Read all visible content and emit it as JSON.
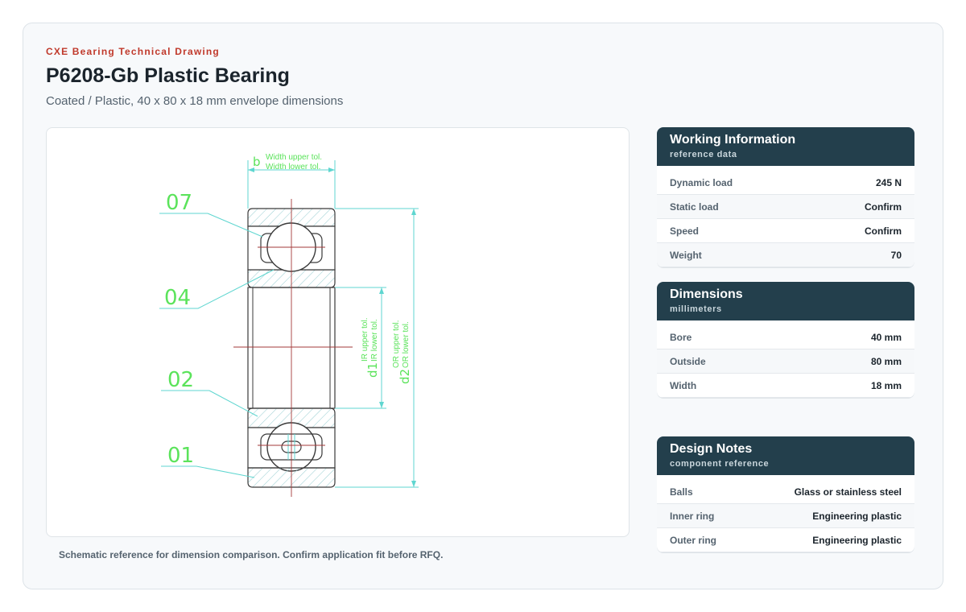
{
  "header": {
    "eyebrow": "CXE Bearing Technical Drawing",
    "title": "P6208-Gb Plastic Bearing",
    "subtitle": "Coated / Plastic, 40 x 80 x 18 mm envelope dimensions"
  },
  "drawing": {
    "labels": {
      "b": "b",
      "width_upper": "Width upper tol.",
      "width_lower": "Width lower tol.",
      "d1": "d1",
      "ir_upper": "IR upper tol.",
      "ir_lower": "IR lower tol.",
      "d2": "d2",
      "or_upper": "OR upper tol.",
      "or_lower": "OR lower tol."
    },
    "callouts": [
      "07",
      "04",
      "02",
      "01"
    ],
    "colors": {
      "outline": "#3a3a3a",
      "hatch": "#9ed0d4",
      "dimension": "#5fd6d0",
      "label": "#5be35b",
      "centerline": "#a33a3a"
    }
  },
  "caption": "Schematic reference for dimension comparison. Confirm application fit before RFQ.",
  "panels": {
    "working": {
      "title": "Working Information",
      "subtitle": "reference data",
      "rows": [
        {
          "k": "Dynamic load",
          "v": "245 N"
        },
        {
          "k": "Static load",
          "v": "Confirm"
        },
        {
          "k": "Speed",
          "v": "Confirm"
        },
        {
          "k": "Weight",
          "v": "70"
        }
      ]
    },
    "dimensions": {
      "title": "Dimensions",
      "subtitle": "millimeters",
      "rows": [
        {
          "k": "Bore",
          "v": "40 mm"
        },
        {
          "k": "Outside",
          "v": "80 mm"
        },
        {
          "k": "Width",
          "v": "18 mm"
        }
      ]
    },
    "notes": {
      "title": "Design Notes",
      "subtitle": "component reference",
      "rows": [
        {
          "k": "Balls",
          "v": "Glass or stainless steel"
        },
        {
          "k": "Inner ring",
          "v": "Engineering plastic"
        },
        {
          "k": "Outer ring",
          "v": "Engineering plastic"
        }
      ]
    }
  },
  "colors": {
    "accent": "#c0392b",
    "panel_header": "#233f4c"
  }
}
